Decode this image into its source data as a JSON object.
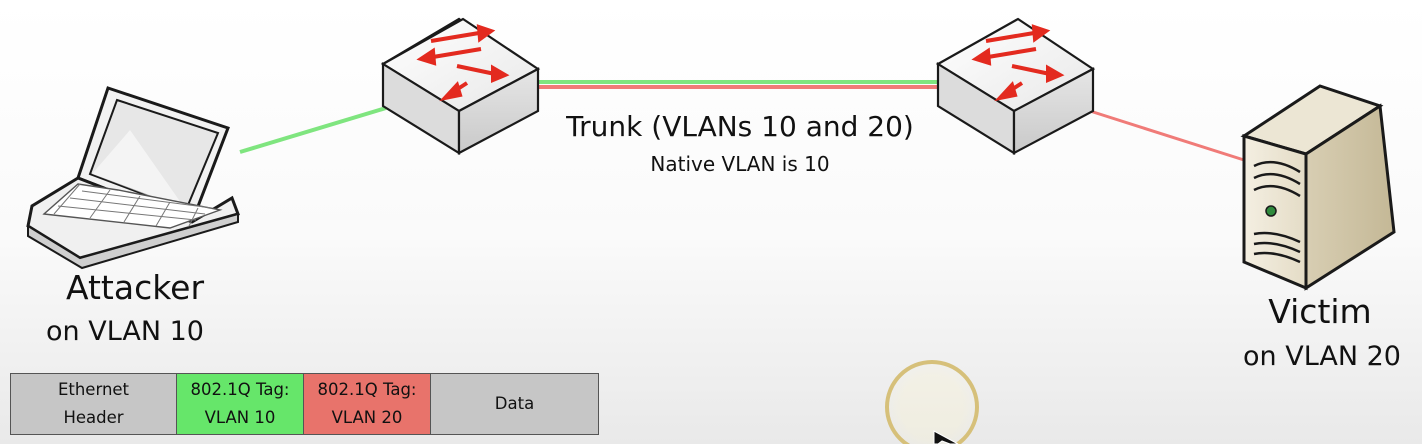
{
  "attacker": {
    "name": "Attacker",
    "vlan": "on VLAN 10"
  },
  "victim": {
    "name": "Victim",
    "vlan": "on VLAN 20"
  },
  "trunk": {
    "title": "Trunk (VLANs 10 and 20)",
    "native": "Native VLAN is 10"
  },
  "frame": {
    "cells": [
      {
        "line1": "Ethernet",
        "line2": "Header"
      },
      {
        "line1": "802.1Q Tag:",
        "line2": "VLAN 10"
      },
      {
        "line1": "802.1Q Tag:",
        "line2": "VLAN 20"
      },
      {
        "line1": "Data"
      }
    ]
  },
  "colors": {
    "vlan10": "#7fe57f",
    "vlan20": "#f07b78",
    "tag10_cell": "#66e66a",
    "tag20_cell": "#e8736b",
    "arrow": "#e32a1f"
  },
  "icons": [
    "laptop-icon",
    "switch-icon",
    "switch-icon",
    "server-icon",
    "cursor-icon"
  ]
}
